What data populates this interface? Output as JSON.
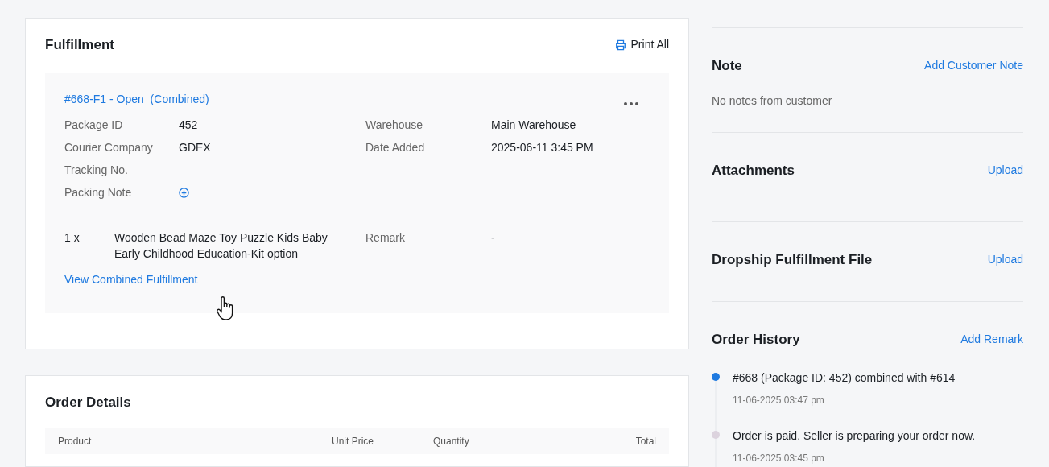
{
  "fulfillment": {
    "title": "Fulfillment",
    "print_all": "Print All",
    "package": {
      "heading": "#668-F1 - Open  (Combined)",
      "fields_left": [
        {
          "label": "Package ID",
          "value": "452"
        },
        {
          "label": "Courier Company",
          "value": "GDEX"
        },
        {
          "label": "Tracking No."
        },
        {
          "label": "Packing Note",
          "kind": "add"
        }
      ],
      "fields_right": [
        {
          "label": "Warehouse",
          "value": "Main Warehouse"
        },
        {
          "label": "Date Added",
          "value": "2025-06-11 3:45 PM"
        }
      ],
      "items": [
        {
          "quantity": "1 x",
          "name": "Wooden Bead Maze Toy Puzzle Kids Baby Early Childhood Education-Kit option",
          "remark_label": "Remark",
          "remark": "-"
        }
      ],
      "link": "View Combined Fulfillment"
    }
  },
  "order_details": {
    "title": "Order Details",
    "columns": [
      "Product",
      "Unit Price",
      "Quantity",
      "Total"
    ]
  },
  "sidebar": [
    {
      "title": "Note",
      "action": "Add Customer Note",
      "body": "No notes from customer"
    },
    {
      "title": "Attachments",
      "action": "Upload"
    },
    {
      "title": "Dropship Fulfillment File",
      "action": "Upload"
    }
  ],
  "order_history": {
    "title": "Order History",
    "action": "Add Remark",
    "entries": [
      {
        "text": "#668 (Package ID: 452) combined with #614",
        "time": "11-06-2025 03:47 pm",
        "color": "#1f7ae0"
      },
      {
        "text": "Order is paid. Seller is preparing your order now.",
        "time": "11-06-2025 03:45 pm",
        "color": "#dcd3de"
      }
    ]
  }
}
